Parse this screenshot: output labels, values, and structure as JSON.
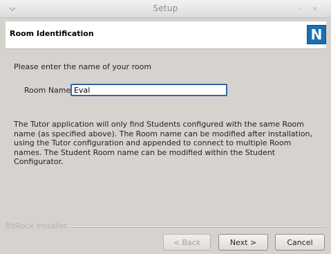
{
  "window": {
    "title": "Setup",
    "minimize_glyph": "–",
    "close_glyph": "×",
    "menu_icon": "chevron-down-icon"
  },
  "header": {
    "title": "Room Identification",
    "logo_text": "N",
    "logo_color": "#1b6fb3"
  },
  "form": {
    "prompt": "Please enter the name of your room",
    "room_name_label": "Room Name",
    "room_name_value": "Eval"
  },
  "description": "The Tutor application will only find Students configured with the same Room name (as specified above).  The Room name can be modified after installation, using the Tutor configuration and appended to connect to multiple Room names.  The Student Room name can be modified within the Student Configurator.",
  "footer": {
    "installer_label": "BitRock Installer",
    "back_label": "< Back",
    "next_label": "Next >",
    "cancel_label": "Cancel"
  }
}
